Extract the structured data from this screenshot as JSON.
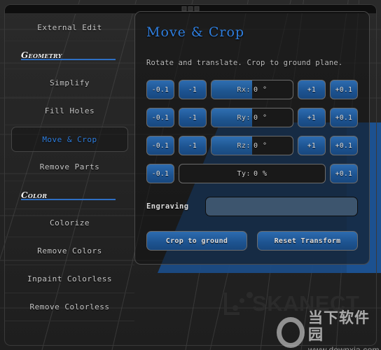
{
  "window": {
    "grip_dots": 3
  },
  "sidebar": {
    "items": [
      {
        "type": "item",
        "label": "External Edit",
        "selected": false
      },
      {
        "type": "header",
        "label": "Geometry"
      },
      {
        "type": "item",
        "label": "Simplify",
        "selected": false
      },
      {
        "type": "item",
        "label": "Fill Holes",
        "selected": false
      },
      {
        "type": "item",
        "label": "Move & Crop",
        "selected": true
      },
      {
        "type": "item",
        "label": "Remove Parts",
        "selected": false
      },
      {
        "type": "header",
        "label": "Color"
      },
      {
        "type": "item",
        "label": "Colorize",
        "selected": false
      },
      {
        "type": "item",
        "label": "Remove Colors",
        "selected": false
      },
      {
        "type": "item",
        "label": "Inpaint Colorless",
        "selected": false
      },
      {
        "type": "item",
        "label": "Remove Colorless",
        "selected": false
      }
    ]
  },
  "panel": {
    "title": "Move & Crop",
    "description": "Rotate and translate. Crop to ground plane.",
    "controls": [
      {
        "key": "Rx:",
        "value": "0 °",
        "fill_percent": 50,
        "left_buttons": [
          "-0.1",
          "-1"
        ],
        "right_buttons": [
          "+1",
          "+0.1"
        ]
      },
      {
        "key": "Ry:",
        "value": "0 °",
        "fill_percent": 50,
        "left_buttons": [
          "-0.1",
          "-1"
        ],
        "right_buttons": [
          "+1",
          "+0.1"
        ]
      },
      {
        "key": "Rz:",
        "value": "0 °",
        "fill_percent": 50,
        "left_buttons": [
          "-0.1",
          "-1"
        ],
        "right_buttons": [
          "+1",
          "+0.1"
        ]
      },
      {
        "key": "Ty:",
        "value": "0 %",
        "fill_percent": 0,
        "left_buttons": [
          "-0.1"
        ],
        "right_buttons": [
          "+0.1"
        ]
      }
    ],
    "engraving": {
      "label": "Engraving",
      "value": "",
      "placeholder": ""
    },
    "actions": [
      {
        "label": "Crop to ground"
      },
      {
        "label": "Reset Transform"
      }
    ]
  },
  "watermarks": {
    "skanect": "SKANECT",
    "downxia_cn": "当下软件园",
    "downxia_url": "www.downxia.com"
  },
  "colors": {
    "accent_blue": "#2f7fe0",
    "button_blue": "#1d5390",
    "panel_bg": "#121212",
    "text": "#c8c8c8",
    "crop_overlay": "#1b4c86"
  }
}
